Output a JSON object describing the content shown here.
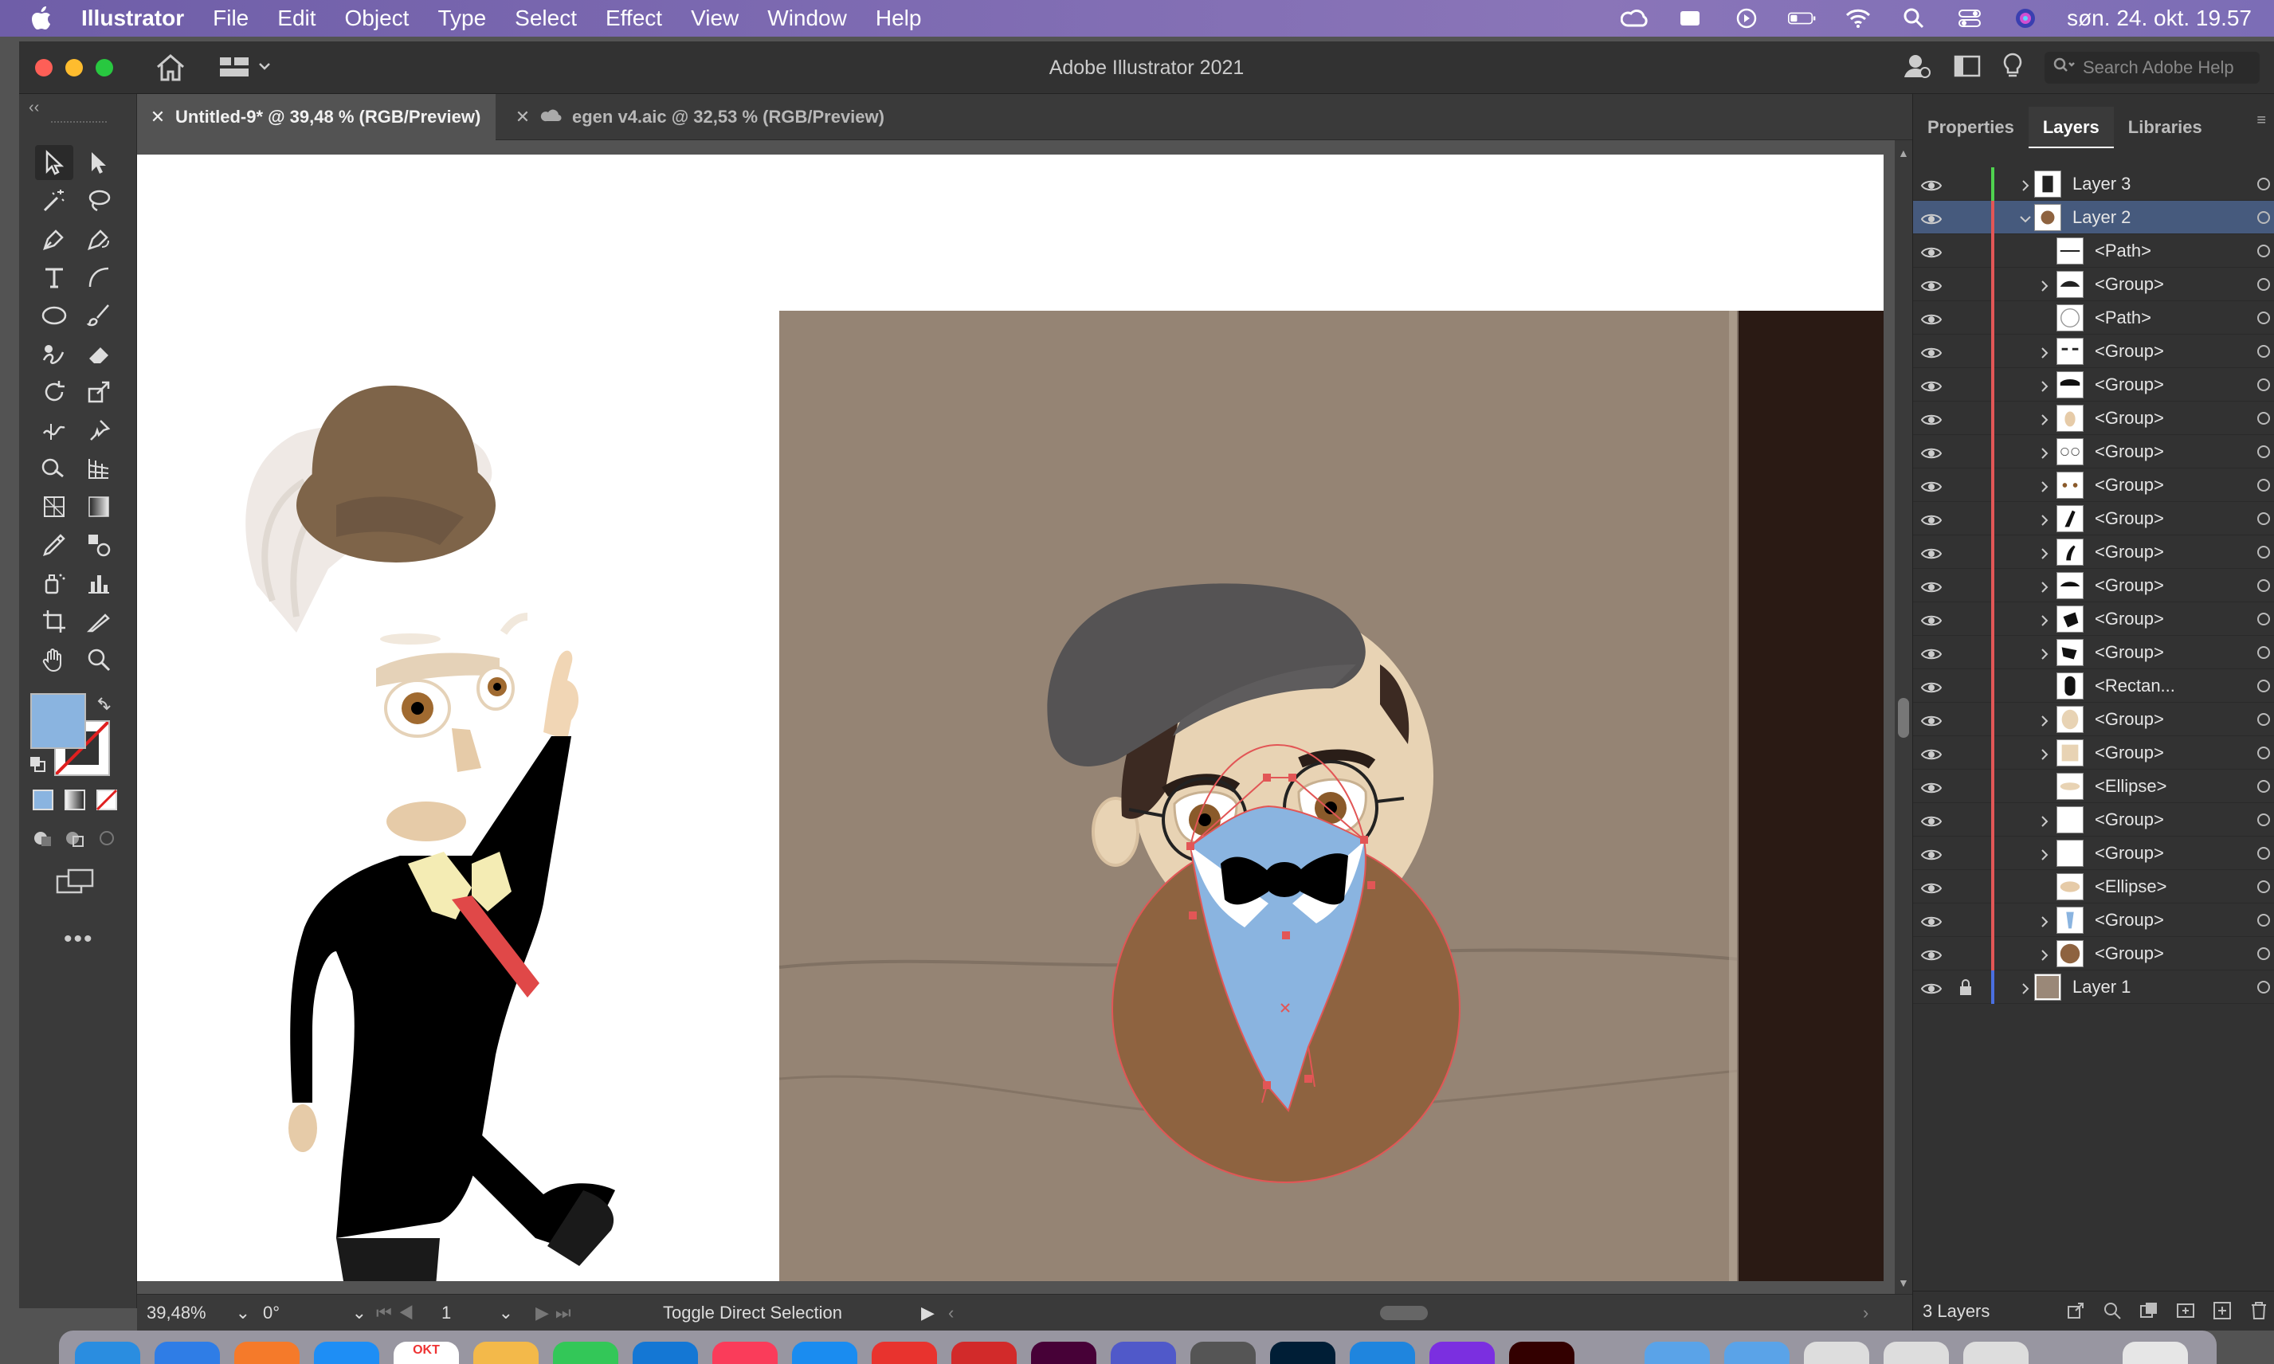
{
  "menubar": {
    "app_name": "Illustrator",
    "items": [
      "File",
      "Edit",
      "Object",
      "Type",
      "Select",
      "Effect",
      "View",
      "Window",
      "Help"
    ],
    "clock": "søn. 24. okt.  19.57"
  },
  "window": {
    "title": "Adobe Illustrator 2021",
    "search_placeholder": "Search Adobe Help"
  },
  "tabs": [
    {
      "label": "Untitled-9* @ 39,48 % (RGB/Preview)"
    },
    {
      "label": "egen v4.aic @ 32,53 % (RGB/Preview)"
    }
  ],
  "statusbar": {
    "zoom": "39,48%",
    "rotation": "0°",
    "artboard": "1",
    "status": "Toggle Direct Selection"
  },
  "panel": {
    "tabs": [
      "Properties",
      "Layers",
      "Libraries"
    ],
    "active_tab": "Layers",
    "layers": [
      {
        "name": "Layer 3",
        "level": 0,
        "expand": "collapsed",
        "color": "#4fd34f"
      },
      {
        "name": "Layer 2",
        "level": 0,
        "expand": "expanded",
        "color": "#e25656",
        "selected": true
      },
      {
        "name": "<Path>",
        "level": 1,
        "expand": "none"
      },
      {
        "name": "<Group>",
        "level": 1,
        "expand": "collapsed"
      },
      {
        "name": "<Path>",
        "level": 1,
        "expand": "none"
      },
      {
        "name": "<Group>",
        "level": 1,
        "expand": "collapsed"
      },
      {
        "name": "<Group>",
        "level": 1,
        "expand": "collapsed"
      },
      {
        "name": "<Group>",
        "level": 1,
        "expand": "collapsed"
      },
      {
        "name": "<Group>",
        "level": 1,
        "expand": "collapsed"
      },
      {
        "name": "<Group>",
        "level": 1,
        "expand": "collapsed"
      },
      {
        "name": "<Group>",
        "level": 1,
        "expand": "collapsed"
      },
      {
        "name": "<Group>",
        "level": 1,
        "expand": "collapsed"
      },
      {
        "name": "<Group>",
        "level": 1,
        "expand": "collapsed"
      },
      {
        "name": "<Group>",
        "level": 1,
        "expand": "collapsed"
      },
      {
        "name": "<Group>",
        "level": 1,
        "expand": "collapsed"
      },
      {
        "name": "<Rectan...",
        "level": 1,
        "expand": "none"
      },
      {
        "name": "<Group>",
        "level": 1,
        "expand": "collapsed"
      },
      {
        "name": "<Group>",
        "level": 1,
        "expand": "collapsed"
      },
      {
        "name": "<Ellipse>",
        "level": 1,
        "expand": "none"
      },
      {
        "name": "<Group>",
        "level": 1,
        "expand": "collapsed"
      },
      {
        "name": "<Group>",
        "level": 1,
        "expand": "collapsed"
      },
      {
        "name": "<Ellipse>",
        "level": 1,
        "expand": "none"
      },
      {
        "name": "<Group>",
        "level": 1,
        "expand": "collapsed"
      },
      {
        "name": "<Group>",
        "level": 1,
        "expand": "collapsed"
      },
      {
        "name": "Layer 1",
        "level": 0,
        "expand": "collapsed",
        "color": "#4a6fe0",
        "locked": true
      }
    ],
    "footer_count": "3 Layers"
  },
  "dock": {
    "calendar_month": "OKT"
  },
  "colors": {
    "fill_swatch": "#8ab4e0",
    "selection_red": "#e25656"
  }
}
